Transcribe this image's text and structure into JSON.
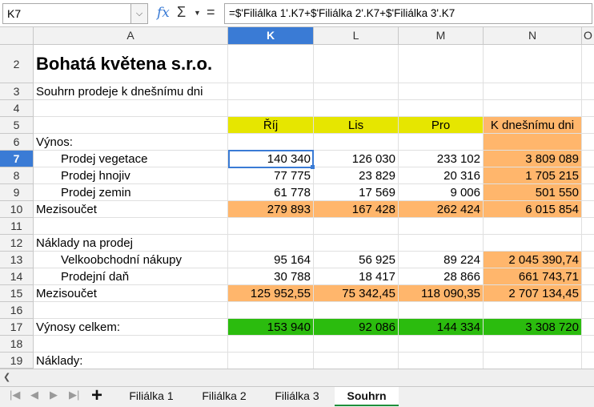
{
  "formula_bar": {
    "name_box": "K7",
    "fx_label": "fx",
    "sigma_label": "Σ",
    "equals_label": "=",
    "formula": "=$'Filiálka 1'.K7+$'Filiálka 2'.K7+$'Filiálka 3'.K7"
  },
  "columns": [
    "A",
    "K",
    "L",
    "M",
    "N",
    "O"
  ],
  "rows": [
    "2",
    "3",
    "4",
    "5",
    "6",
    "7",
    "8",
    "9",
    "10",
    "11",
    "12",
    "13",
    "14",
    "15",
    "16",
    "17",
    "18",
    "19"
  ],
  "selected_cell": "K7",
  "cells": {
    "a2": "Bohatá květena s.r.o.",
    "a3": "Souhrn prodeje k dnešnímu dni",
    "k5": "Říj",
    "l5": "Lis",
    "m5": "Pro",
    "n5": "K dnešnímu dni",
    "a6": "Výnos:",
    "a7": "Prodej vegetace",
    "k7": "140 340",
    "l7": "126 030",
    "m7": "233 102",
    "n7": "3 809 089",
    "a8": "Prodej hnojiv",
    "k8": "77 775",
    "l8": "23 829",
    "m8": "20 316",
    "n8": "1 705 215",
    "a9": "Prodej zemin",
    "k9": "61 778",
    "l9": "17 569",
    "m9": "9 006",
    "n9": "501 550",
    "a10": "Mezisoučet",
    "k10": "279 893",
    "l10": "167 428",
    "m10": "262 424",
    "n10": "6 015 854",
    "a12": "Náklady na prodej",
    "a13": "Velkoobchodní nákupy",
    "k13": "95 164",
    "l13": "56 925",
    "m13": "89 224",
    "n13": "2 045 390,74",
    "a14": "Prodejní daň",
    "k14": "30 788",
    "l14": "18 417",
    "m14": "28 866",
    "n14": "661 743,71",
    "a15": "Mezisoučet",
    "k15": "125 952,55",
    "l15": "75 342,45",
    "m15": "118 090,35",
    "n15": "2 707 134,45",
    "a17": "Výnosy celkem:",
    "k17": "153 940",
    "l17": "92 086",
    "m17": "144 334",
    "n17": "3 308 720",
    "a19": "Náklady:"
  },
  "sheet_tabs": [
    "Filiálka 1",
    "Filiálka 2",
    "Filiálka 3",
    "Souhrn"
  ],
  "active_tab": "Souhrn",
  "colors": {
    "header_fill": "#e6e600",
    "subtotal_fill": "#ffb66c",
    "total_fill": "#2bbc0e",
    "selection": "#3a7bd5"
  }
}
